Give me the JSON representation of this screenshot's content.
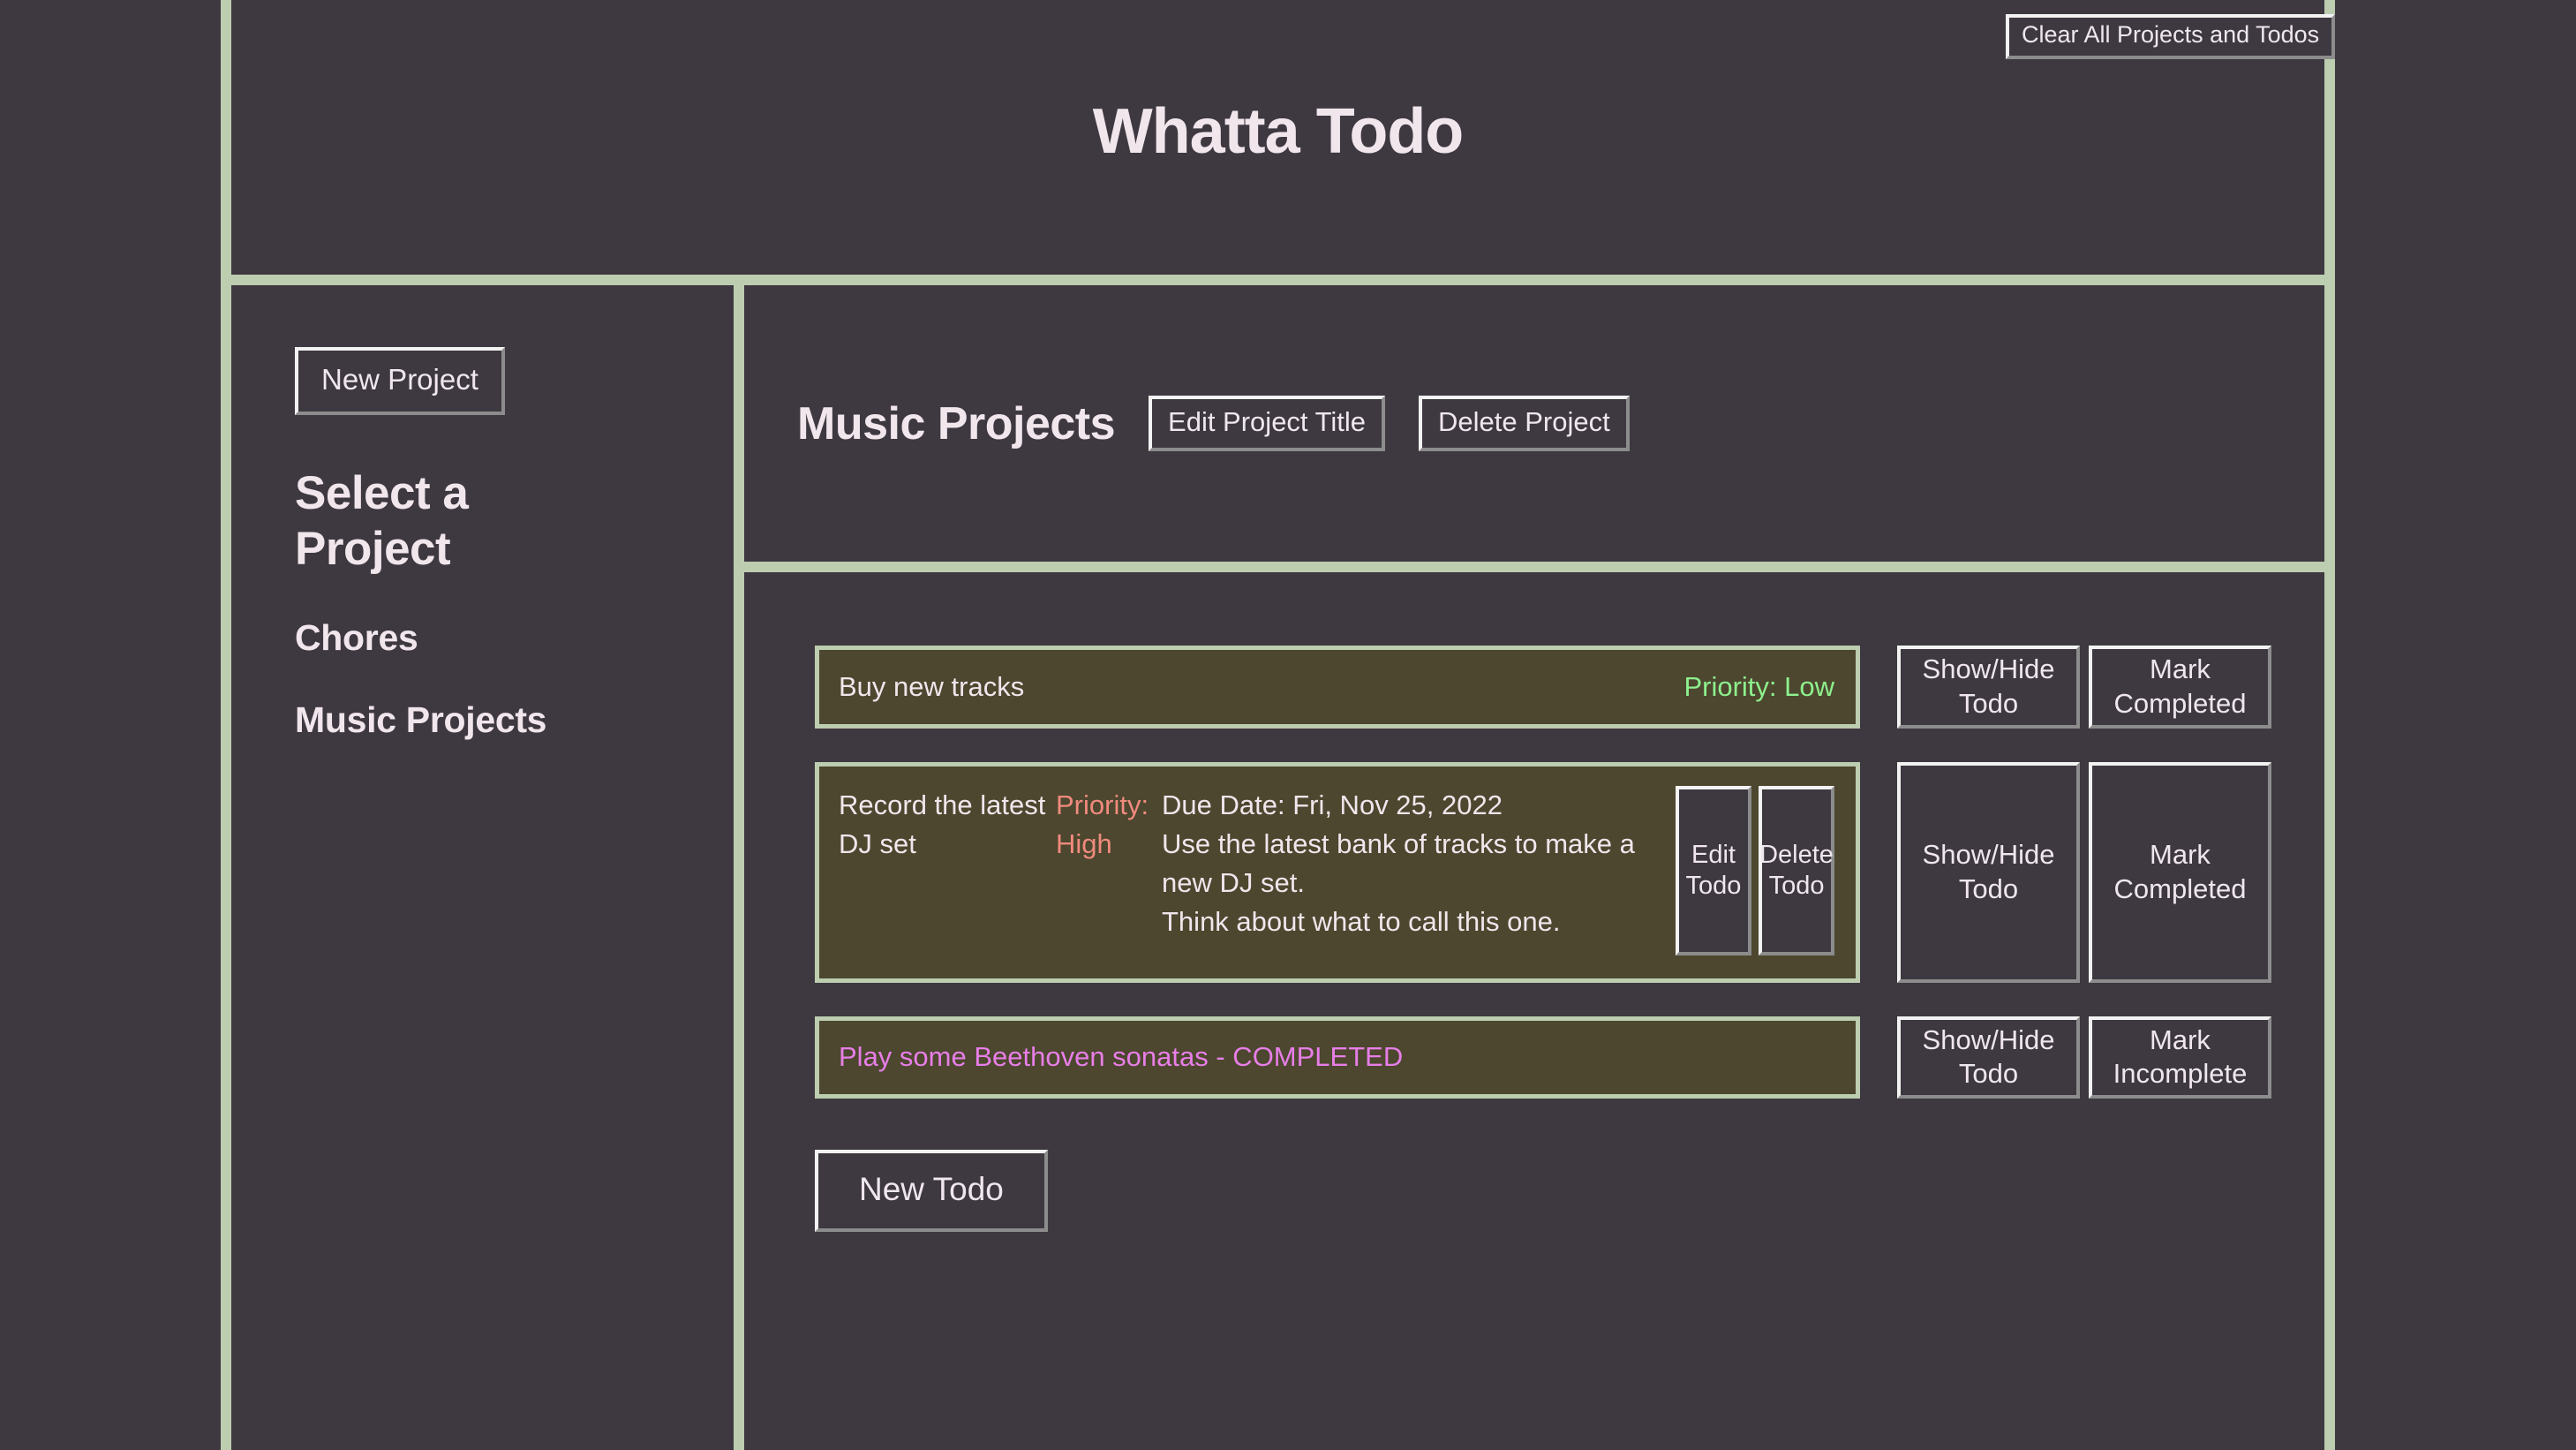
{
  "app": {
    "title": "Whatta Todo",
    "clear_all_label": "Clear All Projects and Todos",
    "colors": {
      "background": "#3e3840",
      "border_accent": "#bccdb0",
      "todo_fill": "#4c472e",
      "text": "#f0e6ec",
      "priority_low": "#8ef08e",
      "priority_high": "#f08a7e",
      "completed": "#e87ee8"
    }
  },
  "sidebar": {
    "new_project_label": "New Project",
    "select_heading": "Select a Project",
    "projects": [
      {
        "label": "Chores"
      },
      {
        "label": "Music Projects"
      }
    ]
  },
  "project": {
    "title": "Music Projects",
    "edit_title_label": "Edit Project Title",
    "delete_label": "Delete Project"
  },
  "todos": {
    "new_todo_label": "New Todo",
    "items": [
      {
        "name": "Buy new tracks",
        "priority_text": "Priority: Low",
        "priority_color": "#8ef08e",
        "expanded": false,
        "completed": false,
        "show_hide_label": "Show/Hide Todo",
        "mark_label": "Mark Completed"
      },
      {
        "name": "Record the latest DJ set",
        "priority_text": "Priority: High",
        "priority_color": "#f08a7e",
        "expanded": true,
        "completed": false,
        "due_date": "Due Date: Fri, Nov 25, 2022",
        "description_line_1": "Use the latest bank of tracks to make a new DJ set.",
        "description_line_2": "Think about what to call this one.",
        "edit_todo_label": "Edit Todo",
        "delete_todo_label": "Delete Todo",
        "show_hide_label": "Show/Hide Todo",
        "mark_label": "Mark Completed"
      },
      {
        "name": "Play some Beethoven sonatas - COMPLETED",
        "expanded": false,
        "completed": true,
        "show_hide_label": "Show/Hide Todo",
        "mark_label": "Mark Incomplete"
      }
    ]
  }
}
